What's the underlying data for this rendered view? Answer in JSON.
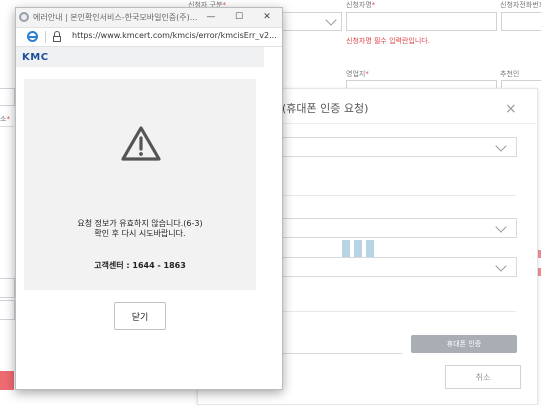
{
  "background": {
    "labels": {
      "category": "신청자 구분",
      "name": "신청자명",
      "phone": "신청자전화번호",
      "branch": "영업지",
      "recommender": "추천인",
      "left_stub": "소"
    },
    "required_mark": "*",
    "error_text": "신청자명 필수 입력란입니다."
  },
  "modal": {
    "title": "(휴대폰 인증 요청)",
    "close_symbol": "×",
    "verify_button": "휴대폰 인증",
    "cancel_button": "취소"
  },
  "popup": {
    "window_title": "에러안내 | 본인확인서비스-한국모바일인증(주)...",
    "url": "https://www.kmcert.com/kmcis/error/kmcisErr_v2...",
    "minimize": "—",
    "maximize": "☐",
    "close": "✕",
    "logo": "KMC",
    "error_line1": "요청 정보가 유효하지 않습니다.(6-3)",
    "error_line2": "확인 후 다시 시도바랍니다.",
    "contact": "고객센터 : 1644 - 1863",
    "close_button": "닫기"
  },
  "colors": {
    "accent_logo": "#1d4f9e",
    "error_red": "#e0434a",
    "loading_bars": "#b8d3e3"
  }
}
